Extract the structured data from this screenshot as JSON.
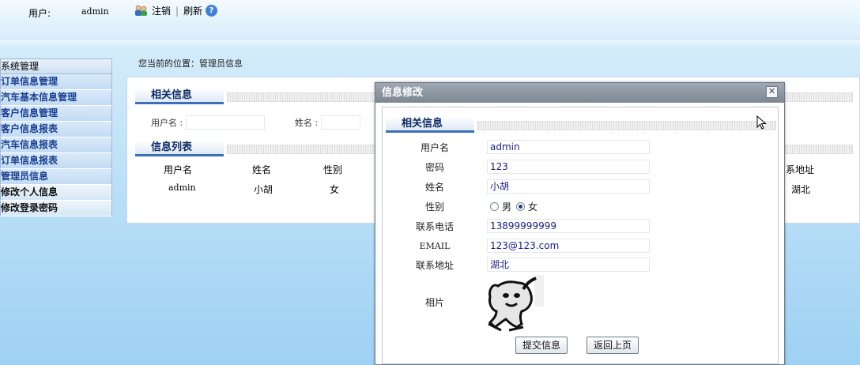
{
  "topbar": {
    "user_label": "用户:",
    "user_name": "admin",
    "logout": "注销",
    "refresh": "刷新",
    "help": "?"
  },
  "sidebar": {
    "items": [
      {
        "label": "系统管理",
        "style": "group"
      },
      {
        "label": "订单信息管理",
        "style": "blue"
      },
      {
        "label": "汽车基本信息管理",
        "style": "blue"
      },
      {
        "label": "客户信息管理",
        "style": "blue"
      },
      {
        "label": "客户信息报表",
        "style": "blue"
      },
      {
        "label": "汽车信息报表",
        "style": "blue"
      },
      {
        "label": "订单信息报表",
        "style": "blue"
      },
      {
        "label": "管理员信息",
        "style": "blue"
      },
      {
        "label": "修改个人信息",
        "style": "dark"
      },
      {
        "label": "修改登录密码",
        "style": "dark"
      }
    ]
  },
  "main": {
    "breadcrumb": "您当前的位置：管理员信息",
    "search_section_title": "相关信息",
    "search_username_label": "用户名 :",
    "search_name_label": "姓名 :",
    "list_section_title": "信息列表",
    "list_columns": [
      "用户名",
      "姓名",
      "性别",
      "系地址"
    ],
    "list_row": {
      "username": "admin",
      "name": "小胡",
      "gender": "女",
      "address": "湖北"
    }
  },
  "modal": {
    "title": "信息修改",
    "close": "✕",
    "section_title": "相关信息",
    "fields": {
      "username_label": "用户名",
      "username_value": "admin",
      "password_label": "密码",
      "password_value": "123",
      "name_label": "姓名",
      "name_value": "小胡",
      "gender_label": "性别",
      "gender_male": "男",
      "gender_female": "女",
      "gender_selected": "女",
      "phone_label": "联系电话",
      "phone_value": "13899999999",
      "email_label": "EMAIL",
      "email_value": "123@123.com",
      "address_label": "联系地址",
      "address_value": "湖北",
      "photo_label": "相片"
    },
    "submit_button": "提交信息",
    "back_button": "返回上页"
  },
  "colors": {
    "accent": "#3b6fba",
    "sidebar_text": "#1b3f93",
    "title_bar": "#8a949e"
  }
}
